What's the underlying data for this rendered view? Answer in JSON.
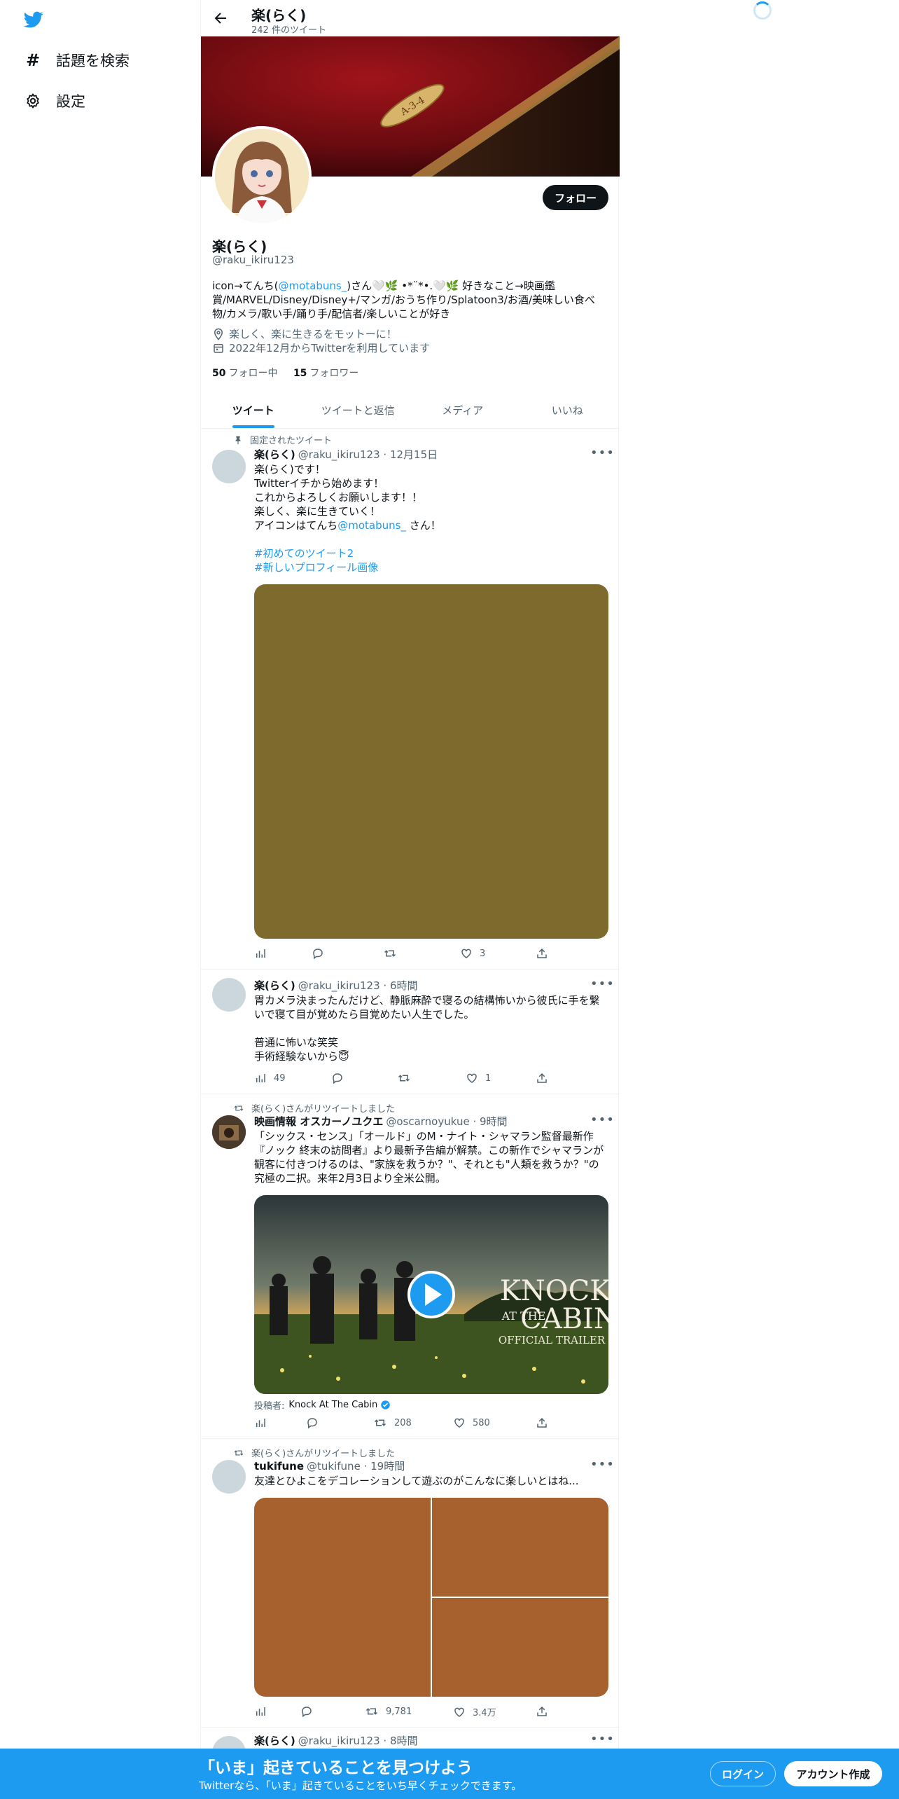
{
  "colors": {
    "accent": "#1d9bf0",
    "text": "#0f1419",
    "secondary": "#536471"
  },
  "nav": {
    "logo_icon": "twitter-bird-icon",
    "explore": {
      "label": "話題を検索",
      "icon": "hashtag-icon"
    },
    "settings": {
      "label": "設定",
      "icon": "gear-icon"
    }
  },
  "header": {
    "title": "楽(らく)",
    "tweet_count": "242 件のツイート"
  },
  "profile": {
    "follow_label": "フォロー",
    "name": "楽(らく)",
    "handle": "@raku_ikiru123",
    "bio_1": "icon→てんち(",
    "bio_mention": "@motabuns_",
    "bio_2": ")さん🤍🌿 •*¨*•.🤍🌿 好きなこと→映画鑑賞/MARVEL/Disney/Disney+/マンガ/おうち作り/Splatoon3/お酒/美味しい食べ物/カメラ/歌い手/踊り手/配信者/楽しいことが好き",
    "location": "楽しく、楽に生きるをモットーに！",
    "joined": "2022年12月からTwitterを利用しています",
    "following_count": "50",
    "following_label": "フォロー中",
    "followers_count": "15",
    "followers_label": "フォロワー"
  },
  "tabs": [
    "ツイート",
    "ツイートと返信",
    "メディア",
    "いいね"
  ],
  "tweets": [
    {
      "context": "固定されたツイート",
      "name": "楽(らく)",
      "meta": "@raku_ikiru123 · 12月15日",
      "text_1": "楽(らく)です！\nTwitterイチから始めます！\nこれからよろしくお願いします！！\n楽しく、楽に生きていく！\nアイコンはてんち",
      "mention": "@motabuns_",
      "text_2": " さん！",
      "hashtag_1": "#初めてのツイート2",
      "hashtag_2": "#新しいプロフィール画像",
      "media_color": "#7d6a2c",
      "views": "",
      "replies": "",
      "retweets": "",
      "likes": "3"
    },
    {
      "name": "楽(らく)",
      "meta": "@raku_ikiru123 · 6時間",
      "text": "胃カメラ決まったんだけど、静脈麻酔で寝るの結構怖いから彼氏に手を繋いで寝て目が覚めたら目覚めたい人生でした。\n\n普通に怖いな笑笑\n手術経験ないから😇",
      "views": "49",
      "replies": "",
      "retweets": "",
      "likes": "1"
    },
    {
      "context": "楽(らく)さんがリツイートしました",
      "name": "映画情報 オスカーノユクエ",
      "meta": "@oscarnoyukue · 9時間",
      "text": "「シックス・センス」「オールド」のM・ナイト・シャマラン監督最新作『ノック 終末の訪問者』より最新予告編が解禁。この新作でシャマランが観客に付きつけるのは、\"家族を救うか？\"、それとも\"人類を救うか？\"の究極の二択。来年2月3日より全米公開。",
      "video_title_1": "KNOCK",
      "video_title_2": "AT THE",
      "video_title_3": "CABIN",
      "video_sub": "OFFICIAL TRAILER",
      "posted_by_label": "投稿者:",
      "posted_by": "Knock At The Cabin",
      "views": "",
      "replies": "",
      "retweets": "208",
      "likes": "580"
    },
    {
      "context": "楽(らく)さんがリツイートしました",
      "name": "tukifune",
      "meta": "@tukifune · 19時間",
      "text": "友達とひよこをデコレーションして遊ぶのがこんなに楽しいとはね...",
      "media_color": "#a6612e",
      "views": "",
      "replies": "",
      "retweets": "9,781",
      "likes": "3.4万"
    },
    {
      "name": "楽(らく)",
      "meta": "@raku_ikiru123 · 8時間"
    }
  ],
  "footer": {
    "title": "「いま」起きていることを見つけよう",
    "subtitle": "Twitterなら、「いま」起きていることをいち早くチェックできます。",
    "login": "ログイン",
    "signup": "アカウント作成"
  }
}
